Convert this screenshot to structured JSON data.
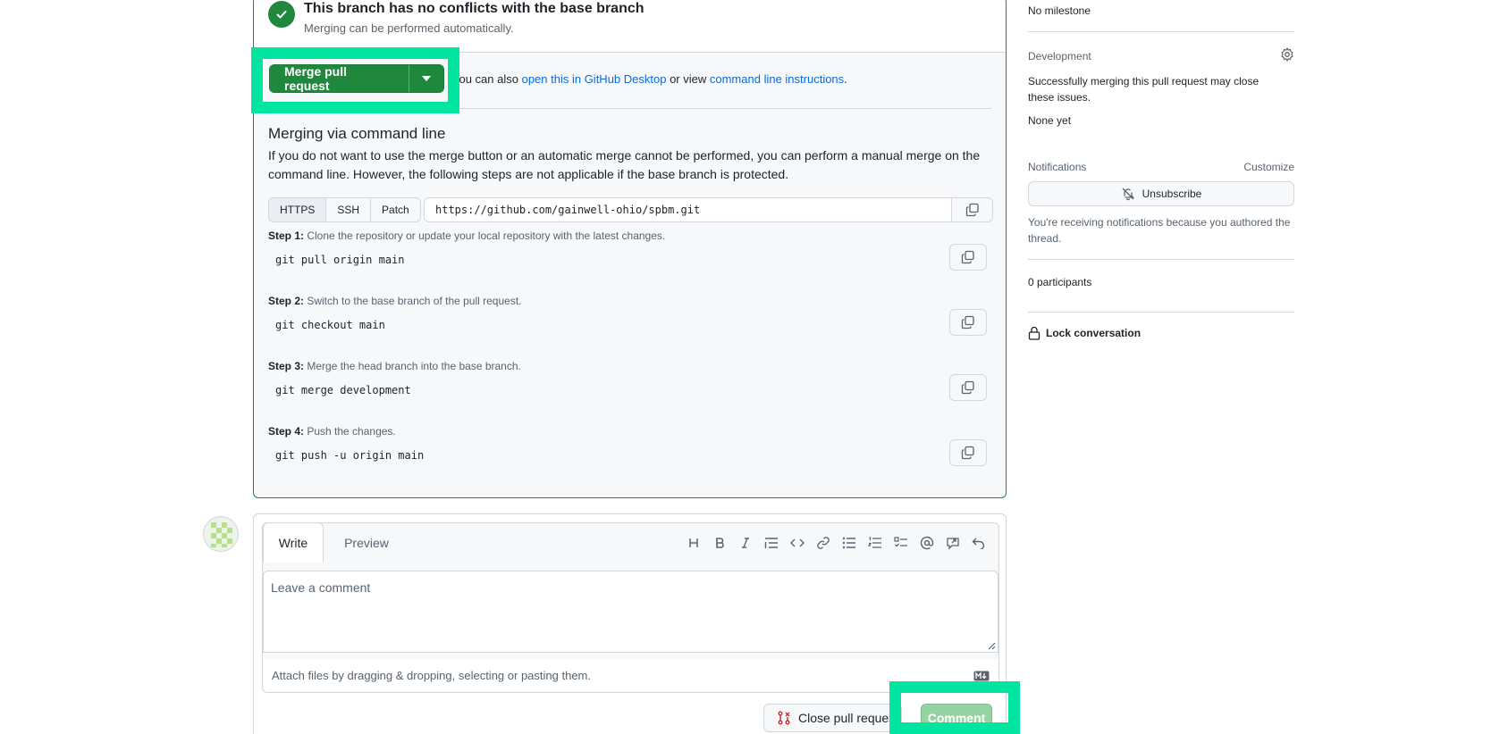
{
  "merge_status": {
    "title": "This branch has no conflicts with the base branch",
    "subtitle": "Merging can be performed automatically."
  },
  "merge_actions": {
    "merge_button": "Merge pull request",
    "alt_prefix": "You can also ",
    "alt_link1": "open this in GitHub Desktop",
    "alt_mid": " or view ",
    "alt_link2": "command line instructions",
    "alt_suffix": "."
  },
  "cli": {
    "title": "Merging via command line",
    "description": "If you do not want to use the merge button or an automatic merge cannot be performed, you can perform a manual merge on the command line. However, the following steps are not applicable if the base branch is protected.",
    "protocols": [
      "HTTPS",
      "SSH",
      "Patch"
    ],
    "selected_protocol": "HTTPS",
    "url": "https://github.com/gainwell-ohio/spbm.git",
    "steps": [
      {
        "label": "Step 1:",
        "text": " Clone the repository or update your local repository with the latest changes.",
        "command": "git pull origin main"
      },
      {
        "label": "Step 2:",
        "text": " Switch to the base branch of the pull request.",
        "command": "git checkout main"
      },
      {
        "label": "Step 3:",
        "text": " Merge the head branch into the base branch.",
        "command": "git merge development"
      },
      {
        "label": "Step 4:",
        "text": " Push the changes.",
        "command": "git push -u origin main"
      }
    ]
  },
  "comment": {
    "tab_write": "Write",
    "tab_preview": "Preview",
    "toolbar_icons": [
      "heading-icon",
      "bold-icon",
      "italic-icon",
      "quote-icon",
      "code-icon",
      "link-icon",
      "unordered-list-icon",
      "ordered-list-icon",
      "task-list-icon",
      "mention-icon",
      "reference-icon",
      "undo-icon"
    ],
    "placeholder": "Leave a comment",
    "attach_text": "Attach files by dragging & dropping, selecting or pasting them.",
    "close_button": "Close pull request",
    "comment_button": "Comment"
  },
  "sidebar": {
    "milestone": "No milestone",
    "development_heading": "Development",
    "development_text": "Successfully merging this pull request may close these issues.",
    "development_none": "None yet",
    "notifications_heading": "Notifications",
    "customize": "Customize",
    "unsubscribe": "Unsubscribe",
    "notifications_text": "You're receiving notifications because you authored the thread.",
    "participants": "0 participants",
    "lock": "Lock conversation"
  },
  "colors": {
    "success_green": "#1f883d",
    "highlight": "#00e5a0",
    "link_blue": "#0969da",
    "disabled_comment": "#94d3a2"
  }
}
